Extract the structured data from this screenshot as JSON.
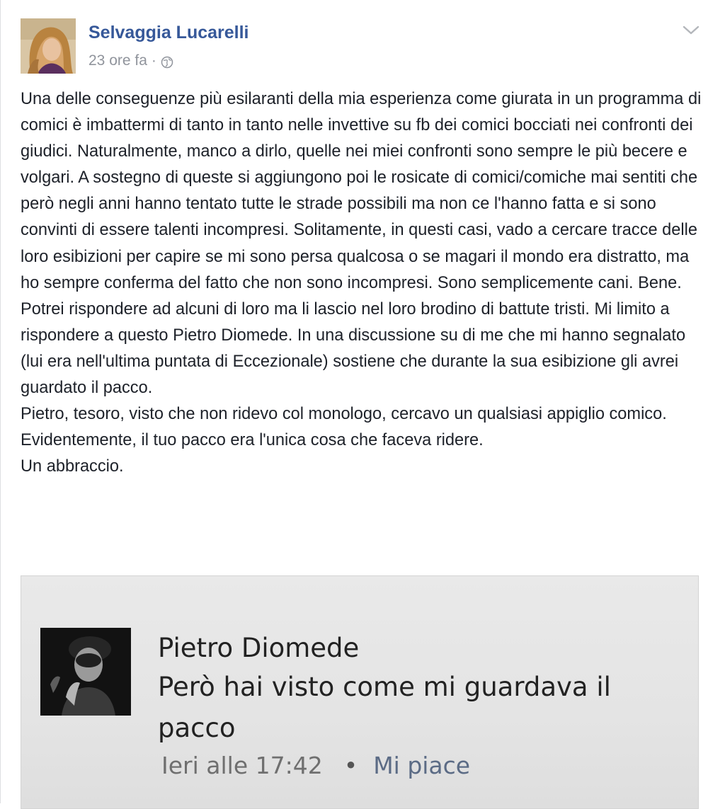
{
  "post": {
    "author": "Selvaggia Lucarelli",
    "timestamp": "23 ore fa",
    "separator": "·",
    "privacy_icon": "globe-icon",
    "options_icon": "chevron-down-icon",
    "paragraphs": [
      "Una delle conseguenze più esilaranti della mia esperienza come giurata in un programma di comici è imbattermi di tanto in tanto nelle invettive su fb dei comici bocciati nei confronti dei giudici. Naturalmente, manco a dirlo, quelle nei miei confronti sono sempre le più becere e volgari. A sostegno di queste si aggiungono poi le rosicate di comici/comiche mai sentiti che però negli anni hanno tentato tutte le strade possibili ma non ce l'hanno fatta e si sono convinti di essere talenti incompresi. Solitamente, in questi casi, vado a cercare tracce delle loro esibizioni per capire se mi sono persa qualcosa o se magari il mondo era distratto, ma ho sempre conferma del fatto che non sono incompresi. Sono semplicemente cani. Bene. Potrei rispondere ad alcuni di loro ma li lascio nel loro brodino di battute tristi. Mi limito a rispondere a questo Pietro Diomede. In una discussione su di me che mi hanno segnalato (lui era nell'ultima puntata di Eccezionale) sostiene che durante la sua esibizione gli avrei guardato il pacco.",
      "Pietro, tesoro, visto che non ridevo col monologo, cercavo un qualsiasi appiglio comico. Evidentemente, il tuo pacco era l'unica cosa che faceva ridere.",
      "Un abbraccio."
    ]
  },
  "attached_image": {
    "comment_author": "Pietro Diomede",
    "comment_text": "Però hai visto come mi guardava il pacco",
    "comment_time": "Ieri alle 17:42",
    "comment_dot": "•",
    "comment_like": "Mi piace"
  },
  "colors": {
    "author_link": "#365899",
    "meta_gray": "#90949c",
    "body_text": "#1d2129",
    "image_background": "#e6e6e6"
  }
}
